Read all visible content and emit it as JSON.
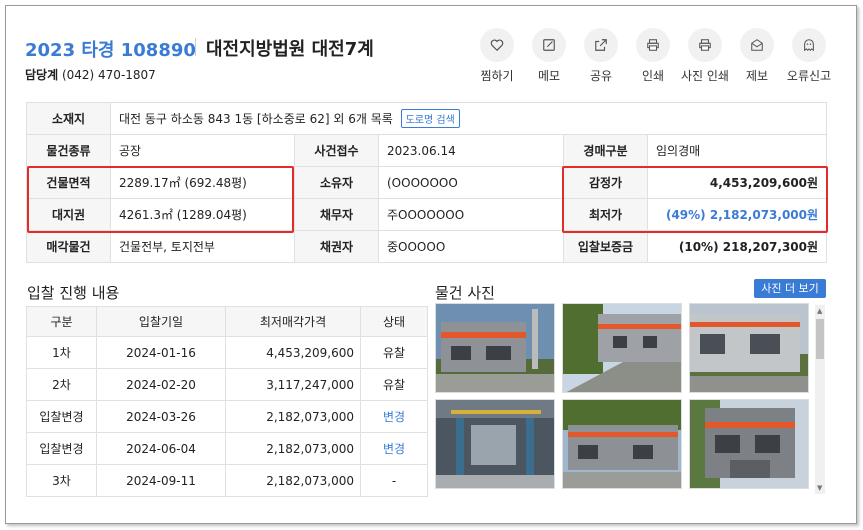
{
  "header": {
    "case_no": "2023 타경 108890",
    "court": "대전지방법원 대전7계",
    "dept_label": "담당계",
    "dept_phone": "(042) 470-1807"
  },
  "actions": [
    {
      "label": "찜하기",
      "icon": "heart-icon"
    },
    {
      "label": "메모",
      "icon": "memo-icon"
    },
    {
      "label": "공유",
      "icon": "share-icon"
    },
    {
      "label": "인쇄",
      "icon": "print-icon"
    },
    {
      "label": "사진 인쇄",
      "icon": "photo-print-icon"
    },
    {
      "label": "제보",
      "icon": "report-icon"
    },
    {
      "label": "오류신고",
      "icon": "error-report-icon"
    }
  ],
  "info": {
    "location_label": "소재지",
    "location_value": "대전 동구 하소동 843 1동 [하소중로 62] 외 6개 목록",
    "road_button": "도로명 검색",
    "type_label": "물건종류",
    "type_value": "공장",
    "received_label": "사건접수",
    "received_value": "2023.06.14",
    "auction_type_label": "경매구분",
    "auction_type_value": "임의경매",
    "building_area_label": "건물면적",
    "building_area_value": "2289.17㎡ (692.48평)",
    "owner_label": "소유자",
    "owner_value": "(OOOOOOO",
    "appraisal_label": "감정가",
    "appraisal_value": "4,453,209,600원",
    "land_right_label": "대지권",
    "land_right_value": "4261.3㎡ (1289.04평)",
    "debtor_label": "채무자",
    "debtor_value": "주OOOOOOO",
    "min_price_label": "최저가",
    "min_price_value": "(49%) 2,182,073,000원",
    "sale_object_label": "매각물건",
    "sale_object_value": "건물전부, 토지전부",
    "creditor_label": "채권자",
    "creditor_value": "중OOOOO",
    "deposit_label": "입찰보증금",
    "deposit_value": "(10%) 218,207,300원"
  },
  "bid": {
    "title": "입찰 진행 내용",
    "headers": [
      "구분",
      "입찰기일",
      "최저매각가격",
      "상태"
    ],
    "rows": [
      [
        "1차",
        "2024-01-16",
        "4,453,209,600",
        "유찰"
      ],
      [
        "2차",
        "2024-02-20",
        "3,117,247,000",
        "유찰"
      ],
      [
        "입찰변경",
        "2024-03-26",
        "2,182,073,000",
        "변경"
      ],
      [
        "입찰변경",
        "2024-06-04",
        "2,182,073,000",
        "변경"
      ],
      [
        "3차",
        "2024-09-11",
        "2,182,073,000",
        "-"
      ]
    ]
  },
  "photos": {
    "title": "물건 사진",
    "more_button": "사진 더 보기"
  },
  "colors": {
    "accent": "#3a7bd5",
    "highlight_box": "#e52a2a"
  }
}
